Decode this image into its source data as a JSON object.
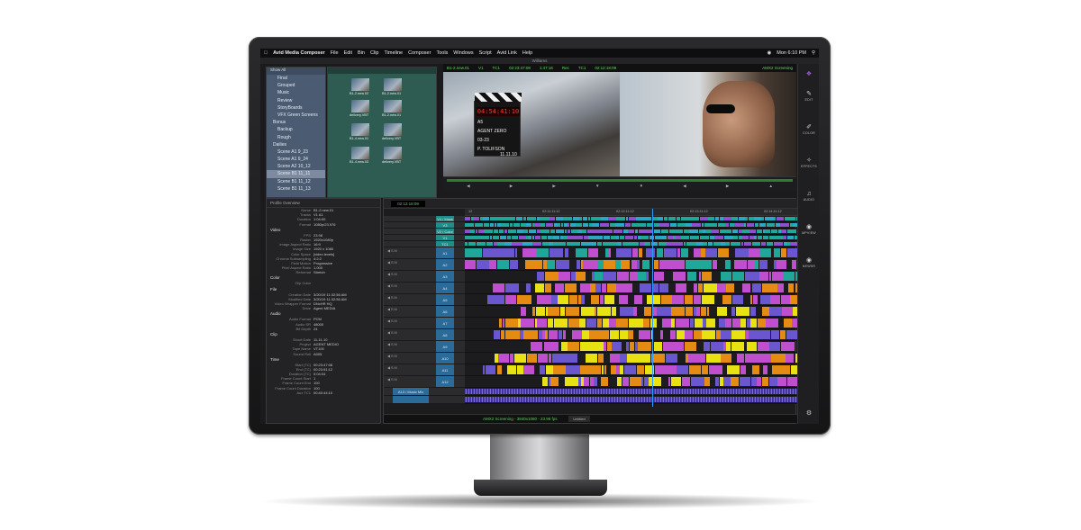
{
  "menubar": {
    "apple_icon": "apple-icon",
    "app_name": "Avid Media Composer",
    "items": [
      "File",
      "Edit",
      "Bin",
      "Clip",
      "Timeline",
      "Composer",
      "Tools",
      "Windows",
      "Script",
      "Avid Link",
      "Help"
    ],
    "clock": "Mon 6:10 PM"
  },
  "window_title": "Williams",
  "bins": {
    "show_label": "Show All",
    "items": [
      {
        "label": "Final",
        "folder": false,
        "selected": false
      },
      {
        "label": "Grouped",
        "folder": false,
        "selected": false
      },
      {
        "label": "Music",
        "folder": false,
        "selected": false
      },
      {
        "label": "Review",
        "folder": false,
        "selected": false
      },
      {
        "label": "StoryBoards",
        "folder": false,
        "selected": false
      },
      {
        "label": "VFX Green Screens",
        "folder": false,
        "selected": false
      },
      {
        "label": "Bonus",
        "folder": true,
        "selected": false
      },
      {
        "label": "Backup",
        "folder": false,
        "selected": false
      },
      {
        "label": "Rough",
        "folder": false,
        "selected": false
      },
      {
        "label": "Dailies",
        "folder": true,
        "selected": false
      },
      {
        "label": "Scene A1 9_23",
        "folder": false,
        "selected": false
      },
      {
        "label": "Scene A1 9_24",
        "folder": false,
        "selected": false
      },
      {
        "label": "Scene A2 10_12",
        "folder": false,
        "selected": false
      },
      {
        "label": "Scene B1 11_11",
        "folder": false,
        "selected": true
      },
      {
        "label": "Scene B1 11_12",
        "folder": false,
        "selected": false
      },
      {
        "label": "Scene B1 11_13",
        "folder": false,
        "selected": false
      }
    ],
    "thumbs": [
      "B1-2.new.02",
      "B1-2.new.01",
      "delivery.VBT",
      "B1-2.new.01",
      "B1-4.new.01",
      "delivery.VBT",
      "B1-4.new.03",
      "delivery.VBT"
    ]
  },
  "monitors": {
    "source_clip": "B1-2.new.01",
    "source_track": "V1",
    "source_tc_label": "TC1",
    "source_tc": "02:23:47:08",
    "rec_duration": "1:47:16",
    "rec_label": "Rec",
    "rec_tc_label": "TC1",
    "rec_tc": "02:12:18:09",
    "sequence": "AMX2 Screening",
    "clapper": {
      "timecode": "04:54:41:10",
      "scene_label": "A5",
      "title": "AGENT ZERO",
      "director": "P. TOLIFSON",
      "date": "11.11.10",
      "roll": "03-23"
    }
  },
  "side_tools": [
    {
      "icon": "edit-icon",
      "label": "EDIT"
    },
    {
      "icon": "color-icon",
      "label": "COLOR"
    },
    {
      "icon": "effects-icon",
      "label": "EFFECTS"
    },
    {
      "icon": "audio-icon",
      "label": "AUDIO"
    },
    {
      "icon": "mpview-icon",
      "label": "MPVIEW"
    },
    {
      "icon": "newsr-icon",
      "label": "NEWSR"
    }
  ],
  "inspector": {
    "profile": "Overview",
    "fields": [
      {
        "k": "Name",
        "v": "B1-2.new.01"
      },
      {
        "k": "Tracks",
        "v": "V1 A1"
      },
      {
        "k": "Duration",
        "v": "1:04:00"
      },
      {
        "k": "Format",
        "v": "1080p/23.976"
      }
    ],
    "sections": [
      {
        "title": "Video",
        "rows": [
          {
            "k": "FPS",
            "v": "23.98"
          },
          {
            "k": "Raster",
            "v": "1920x1080p"
          },
          {
            "k": "Image Aspect Ratio",
            "v": "16:9"
          },
          {
            "k": "Image Size",
            "v": "1920 x 1080"
          },
          {
            "k": "Color Space",
            "v": "[video levels]"
          },
          {
            "k": "Chroma Subsampling",
            "v": "4:2:2"
          },
          {
            "k": "Field Motion",
            "v": "Progressive"
          },
          {
            "k": "Pixel Aspect Ratio",
            "v": "1.000"
          },
          {
            "k": "Reformat",
            "v": "Stretch"
          }
        ]
      },
      {
        "title": "Color",
        "rows": [
          {
            "k": "Clip Color",
            "v": ""
          }
        ]
      },
      {
        "title": "File",
        "rows": [
          {
            "k": "Creation Date",
            "v": "3/20/19 11:32:56 AM"
          },
          {
            "k": "Modified Date",
            "v": "3/20/19 11:32:56 AM"
          },
          {
            "k": "Video Wrapper Format",
            "v": "DNxHR HQ"
          },
          {
            "k": "Drive",
            "v": "Agent MEDIA"
          }
        ]
      },
      {
        "title": "Audio",
        "rows": [
          {
            "k": "Audio Format",
            "v": "PCM"
          },
          {
            "k": "Audio SR",
            "v": "48000"
          },
          {
            "k": "Bit Depth",
            "v": "24"
          }
        ]
      },
      {
        "title": "Clip",
        "rows": [
          {
            "k": "Shoot Date",
            "v": "11-11-10"
          },
          {
            "k": "Project",
            "v": "AGENT MEDIO"
          },
          {
            "k": "Tape Name",
            "v": "VT100"
          },
          {
            "k": "Sound Roll",
            "v": "A005"
          }
        ]
      },
      {
        "title": "Time",
        "rows": [
          {
            "k": "Start (TC)",
            "v": "00:23:47:08"
          },
          {
            "k": "End (TC)",
            "v": "00:23:51:12"
          },
          {
            "k": "Duration (TC)",
            "v": "0:04:04"
          },
          {
            "k": "Frame Count Start",
            "v": "1"
          },
          {
            "k": "Frame Count End",
            "v": "100"
          },
          {
            "k": "Frame Count Duration",
            "v": "100"
          },
          {
            "k": "Aux TC1",
            "v": "00:40:44:10"
          }
        ]
      }
    ]
  },
  "timeline": {
    "timecode": "02:12:18:09",
    "ruler": [
      "12",
      "02:11:11:12",
      "02:12:11:12",
      "02:13:11:12",
      "02:14:11:12"
    ],
    "tracks": [
      {
        "name": "V4 / Mask",
        "type": "vid"
      },
      {
        "name": "V3",
        "type": "vid"
      },
      {
        "name": "V2 / Color",
        "type": "vid"
      },
      {
        "name": "V1",
        "type": "vid"
      },
      {
        "name": "TC1",
        "type": "vid"
      },
      {
        "name": "A1",
        "type": "aud"
      },
      {
        "name": "A2",
        "type": "aud"
      },
      {
        "name": "A3",
        "type": "aud"
      },
      {
        "name": "A4",
        "type": "aud"
      },
      {
        "name": "A5",
        "type": "aud"
      },
      {
        "name": "A6",
        "type": "aud"
      },
      {
        "name": "A7",
        "type": "aud"
      },
      {
        "name": "A8",
        "type": "aud"
      },
      {
        "name": "A9",
        "type": "aud"
      },
      {
        "name": "A10",
        "type": "aud"
      },
      {
        "name": "A11",
        "type": "aud"
      },
      {
        "name": "A12",
        "type": "aud"
      },
      {
        "name": "A13 / Music Mix",
        "type": "mix"
      },
      {
        "name": "",
        "type": "mix"
      }
    ],
    "status": "AMX2 Screening - 3840x1080 - 23.98 fps",
    "mode": "Untitled"
  },
  "colors": {
    "video_clip": "#1fa89a",
    "audio_magenta": "#c04fcf",
    "audio_orange": "#e58a12",
    "audio_yellow": "#e8e213",
    "audio_purple": "#6a56cf",
    "bin_list_bg": "#4a5b72",
    "bin_thumb_bg": "#2f5c52",
    "timecode_green": "#5ecb5e"
  }
}
